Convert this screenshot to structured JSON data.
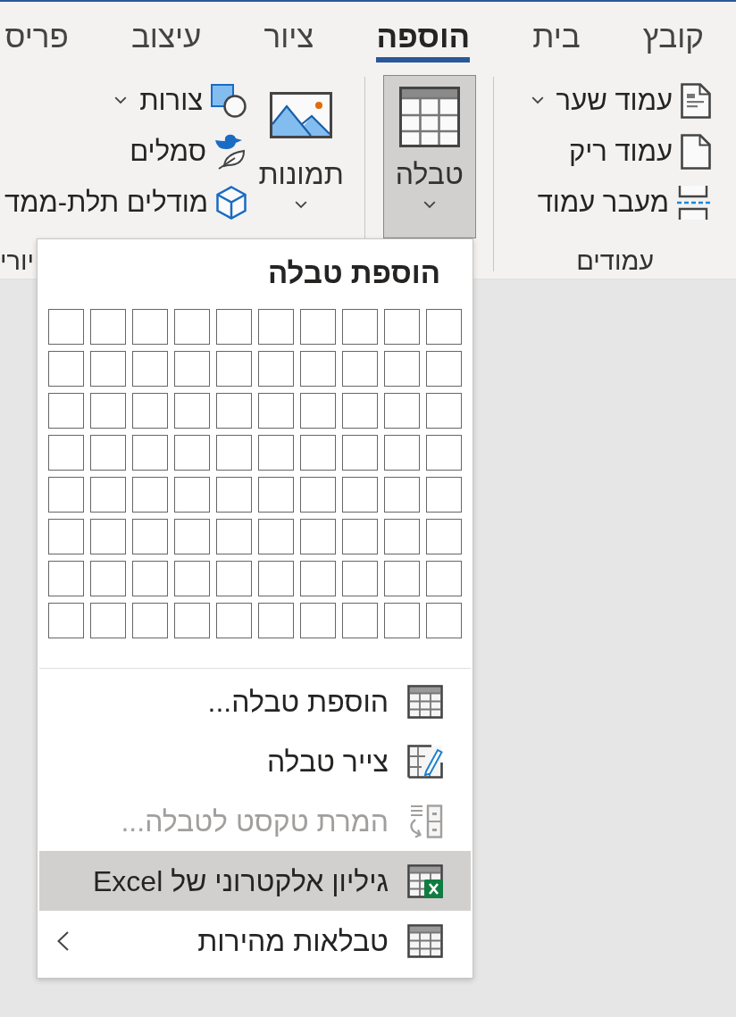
{
  "tabs": [
    {
      "label": "קובץ",
      "selected": false
    },
    {
      "label": "בית",
      "selected": false
    },
    {
      "label": "הוספה",
      "selected": true
    },
    {
      "label": "ציור",
      "selected": false
    },
    {
      "label": "עיצוב",
      "selected": false
    },
    {
      "label": "פריס",
      "selected": false
    }
  ],
  "ribbon": {
    "pages_group": {
      "label": "עמודים",
      "items": [
        {
          "label": "עמוד שער",
          "has_menu": true
        },
        {
          "label": "עמוד ריק",
          "has_menu": false
        },
        {
          "label": "מעבר עמוד",
          "has_menu": false
        }
      ]
    },
    "table_group": {
      "button": {
        "label": "טבלה",
        "pressed": true,
        "has_menu": true
      }
    },
    "illustrations_group": {
      "label": "יורי",
      "pictures_button": {
        "label": "תמונות",
        "has_menu": true
      },
      "items": [
        {
          "label": "צורות",
          "has_menu": true
        },
        {
          "label": "סמלים",
          "has_menu": false
        },
        {
          "label": "מודלים תלת-ממד",
          "has_menu": false
        }
      ]
    }
  },
  "table_menu": {
    "title": "הוספת טבלה",
    "items": [
      {
        "label": "הוספת טבלה...",
        "disabled": false,
        "highlighted": false,
        "has_submenu": false
      },
      {
        "label": "צייר טבלה",
        "disabled": false,
        "highlighted": false,
        "has_submenu": false
      },
      {
        "label": "המרת טקסט לטבלה...",
        "disabled": true,
        "highlighted": false,
        "has_submenu": false
      },
      {
        "label": "גיליון אלקטרוני של Excel",
        "disabled": false,
        "highlighted": true,
        "has_submenu": false
      },
      {
        "label": "טבלאות מהירות",
        "disabled": false,
        "highlighted": false,
        "has_submenu": true
      }
    ]
  }
}
